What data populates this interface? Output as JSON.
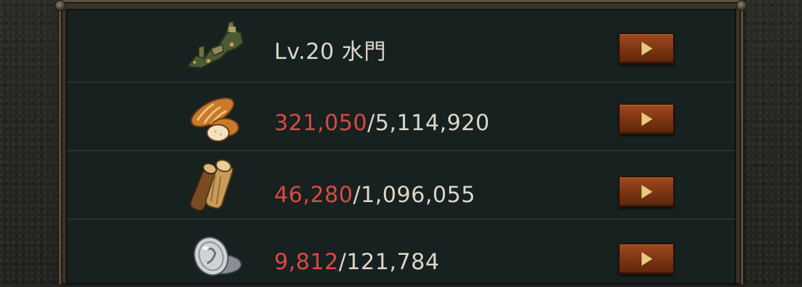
{
  "colors": {
    "panel_bg": "#172120",
    "text": "#dcd7c9",
    "current_amount": "#d84a43",
    "button": "#8a3c16",
    "button_arrow": "#e8c87a"
  },
  "rows": [
    {
      "icon": "castle-gate-icon",
      "label": "Lv.20 水門"
    },
    {
      "icon": "bread-food-icon",
      "current": "321,050",
      "separator": "/",
      "required": "5,114,920"
    },
    {
      "icon": "wood-logs-icon",
      "current": "46,280",
      "separator": "/",
      "required": "1,096,055"
    },
    {
      "icon": "silver-coins-icon",
      "current": "9,812",
      "separator": "/",
      "required": "121,784"
    }
  ],
  "button_icon": "play-arrow-icon"
}
